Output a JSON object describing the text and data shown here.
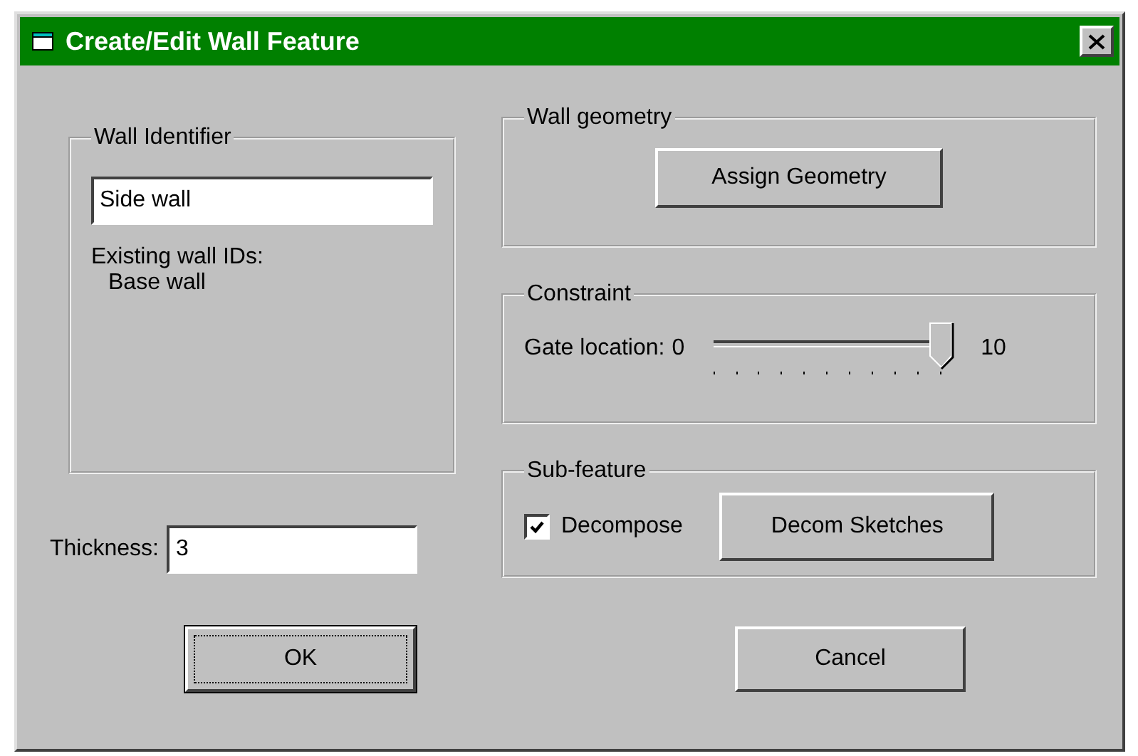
{
  "window": {
    "title": "Create/Edit Wall Feature"
  },
  "wall_identifier": {
    "title": "Wall Identifier",
    "field": {
      "value": "Side wall"
    },
    "existing_label": "Existing wall IDs:",
    "existing_ids": [
      "Base wall"
    ]
  },
  "thickness": {
    "label": "Thickness:",
    "value": "3"
  },
  "wall_geometry": {
    "title": "Wall geometry",
    "button": "Assign Geometry"
  },
  "constraint": {
    "title": "Constraint",
    "slider": {
      "label": "Gate location:",
      "min_label": "0",
      "max_label": "10",
      "level": 1
    }
  },
  "sub_feature": {
    "title": "Sub-feature",
    "checkbox": {
      "label": "Decompose",
      "checked": true
    },
    "button": "Decom Sketches"
  },
  "buttons": [
    {
      "label": "OK",
      "default": true
    },
    {
      "label": "Cancel",
      "default": false
    }
  ]
}
